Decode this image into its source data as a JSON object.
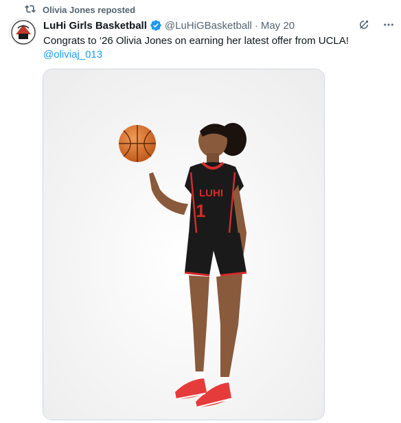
{
  "repost": {
    "icon": "repost-icon",
    "label": "Olivia Jones reposted"
  },
  "tweet": {
    "author": {
      "display_name": "LuHi Girls Basketball",
      "handle": "@LuHiGBasketball",
      "verified": true,
      "avatar_icon": "team-logo-avatar"
    },
    "separator": "·",
    "date": "May 20",
    "text": "Congrats to ‘26 Olivia Jones on earning her latest offer from UCLA!",
    "mention": "@oliviaj_013",
    "media": {
      "icon": "player-photo",
      "jersey_text": "LUHI",
      "jersey_number": "1"
    }
  },
  "actions": {
    "grok_icon": "grok-icon",
    "more_icon": "more-icon"
  },
  "colors": {
    "accent": "#1d9bf0",
    "secondary_text": "#536471",
    "jersey": "#1a1a1a",
    "trim": "#d62b2b"
  }
}
